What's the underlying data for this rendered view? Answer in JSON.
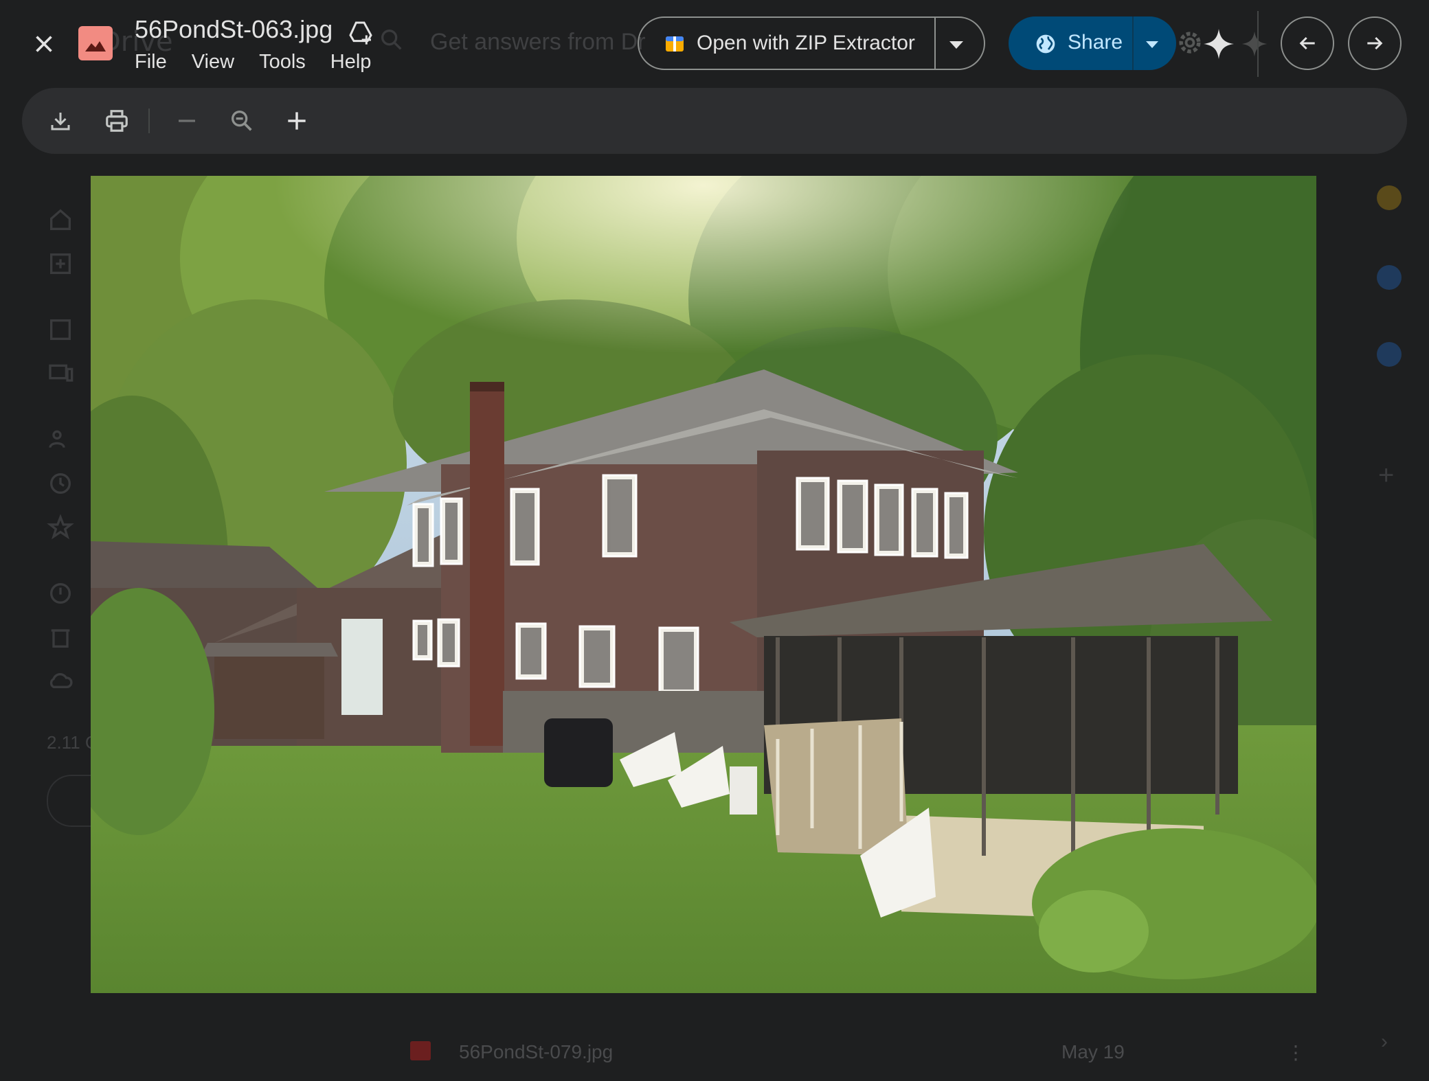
{
  "viewer": {
    "file_name": "56PondSt-063.jpg",
    "menu": [
      "File",
      "View",
      "Tools",
      "Help"
    ],
    "open_with_label": "Open with ZIP Extractor",
    "share_label": "Share"
  },
  "background": {
    "app_logo_text": "Drive",
    "search_placeholder": "Get answers from Dr",
    "storage_text": "2.11 G",
    "file_row": {
      "name": "56PondSt-079.jpg",
      "date": "May 19"
    }
  },
  "photo": {
    "subject": "house-backyard-photo"
  },
  "icons": {
    "close": "close-icon",
    "image_file": "image-file-icon",
    "add_to_drive": "add-to-drive-icon",
    "zip": "zip-extractor-icon",
    "globe": "globe-icon",
    "download": "download-icon",
    "print": "print-icon",
    "zoom_out": "zoom-out-icon",
    "zoom": "zoom-icon",
    "zoom_in": "zoom-in-icon",
    "prev": "arrow-left-icon",
    "next": "arrow-right-icon",
    "gemini": "sparkle-icon"
  },
  "colors": {
    "background": "#1e1f20",
    "toolbar": "#2d2e30",
    "share_button": "#004a77",
    "share_text": "#c2e7ff",
    "file_icon": "#f28b82"
  }
}
